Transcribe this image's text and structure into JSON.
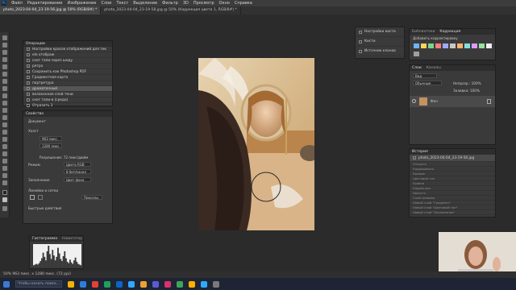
{
  "menu": {
    "app": "Ps",
    "items": [
      "Файл",
      "Редактирование",
      "Изображение",
      "Слои",
      "Текст",
      "Выделение",
      "Фильтр",
      "3D",
      "Просмотр",
      "Окно",
      "Справка"
    ]
  },
  "tabs": [
    {
      "label": "photo_2023-04-04_23-19-56.jpg @ 50% (RGB/8#) *"
    },
    {
      "label": "photo_2023-04-04_23-19-58.jpg @ 50% (Коррекция цвета 1, RGB/8#) *"
    }
  ],
  "actions_panel": {
    "title": "Операции",
    "rows": [
      {
        "label": "Настройки красок отображений для тек"
      },
      {
        "label": "ele отображ"
      },
      {
        "label": "снег тапи-через шеду"
      },
      {
        "label": "ретро"
      },
      {
        "label": "Сохранить как Photoshop PDF"
      },
      {
        "label": "Градиентная карта"
      },
      {
        "label": "портретура"
      },
      {
        "label": "драматичный",
        "selected": true
      },
      {
        "label": "волоконная спой тени"
      },
      {
        "label": "снег тапи-в (среда)"
      },
      {
        "label": "Отразить 3"
      }
    ]
  },
  "properties_panel": {
    "title": "Свойства",
    "doc_label": "Документ",
    "canvas_section": "Холст",
    "width": "963 пикс.",
    "height": "1280 пикс.",
    "resolution_label": "Разрешение: 72 пикс/дюйм",
    "mode_label": "Режим",
    "mode_value": "Цвета RGB",
    "depth_value": "8 бит/канал",
    "fill_label": "Заполнение",
    "fill_value": "Цвет фона",
    "rulers_section": "Линейки и сетки",
    "rulers_unit": "Пикселы",
    "quick_actions": "Быстрые действия"
  },
  "histogram_panel": {
    "tabs": [
      "Гистограмма",
      "Навигатор"
    ],
    "values": [
      2,
      3,
      4,
      3,
      5,
      8,
      12,
      20,
      14,
      9,
      22,
      30,
      18,
      11,
      24,
      16,
      9,
      14,
      27,
      19,
      11,
      8,
      15,
      22,
      12,
      7,
      5,
      10,
      6,
      4,
      9,
      13,
      7,
      4,
      3,
      2
    ]
  },
  "adjust_mini_panel": {
    "items": [
      "Настройки кисти",
      "Кисти",
      "Источник клонов"
    ]
  },
  "libraries_panel": {
    "tabs": [
      "Библиотеки",
      "Коррекция"
    ],
    "hint": "Добавить корректировку",
    "swatch_colors": [
      "#6fb1ff",
      "#ffd25a",
      "#77d88b",
      "#ff7a7a",
      "#9fa8ff",
      "#c7c7c7",
      "#ffb36b",
      "#80dfe0",
      "#d79bff",
      "#9be09b",
      "#f0f0f0",
      "#a0a0a0"
    ]
  },
  "layers_panel": {
    "tabs": [
      "Слои",
      "Каналы"
    ],
    "kind_label": "Вид",
    "mode_label": "Обычные",
    "opacity_label": "Непрозр.: 100%",
    "fill_label": "Заливка: 100%",
    "layer_name": "Фон"
  },
  "history_panel": {
    "title": "История",
    "snapshot": "photo_2023-04-04_23-19-56.jpg",
    "steps": [
      "Открыть",
      "Кадрировать",
      "Кривые",
      "Цветовой тон",
      "Уровни",
      "Коррекция",
      "Яркость",
      "Слой-заливка",
      "Новый слой \"Градиент\"",
      "Новый слой \"Цветовой тон\"",
      "Новый слой \"Затемнение\""
    ]
  },
  "status": {
    "text": "50%    963 пикс. x 1280 пикс. (72 ppi)"
  },
  "taskbar": {
    "search_placeholder": "Чтобы начать поиск...",
    "icon_colors": [
      "#f5b400",
      "#2e7dd7",
      "#e34133",
      "#1f9f5b",
      "#0a66c2",
      "#31a8ff",
      "#f0a030",
      "#5b5bd6",
      "#d6336c",
      "#3ba55c",
      "#ffb000",
      "#31a8ff",
      "#7a7a7a"
    ]
  }
}
